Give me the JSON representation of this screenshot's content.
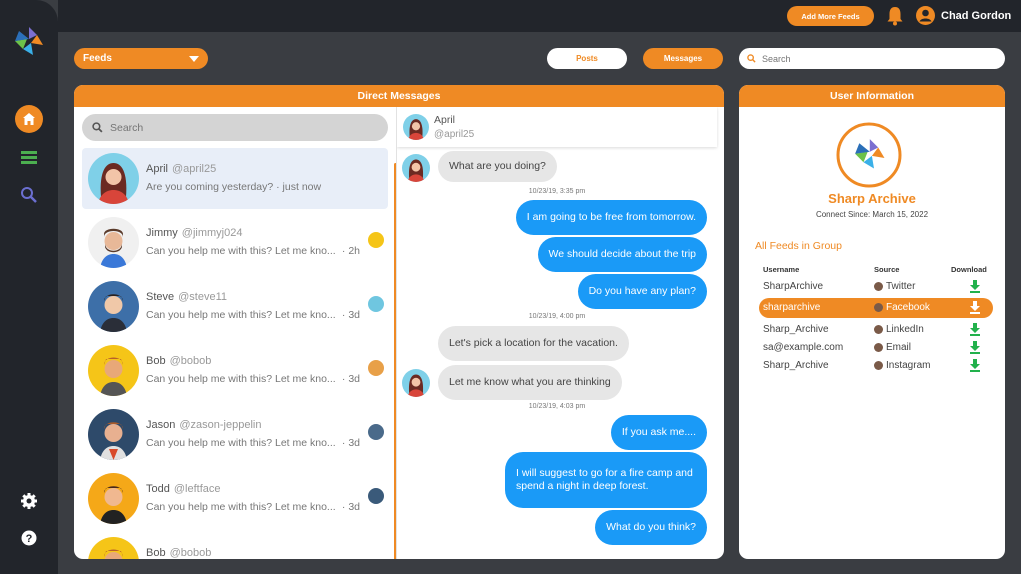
{
  "topbar": {
    "add_feeds_label": "Add More Feeds",
    "user_name": "Chad Gordon"
  },
  "toolbar": {
    "feeds_label": "Feeds",
    "posts_label": "Posts",
    "messages_label": "Messages",
    "search_placeholder": "Search"
  },
  "dm": {
    "title": "Direct Messages",
    "search_placeholder": "Search",
    "conversations": [
      {
        "name": "April",
        "handle": "@april25",
        "message": "Are you coming yesterday? · just now",
        "time": ""
      },
      {
        "name": "Jimmy",
        "handle": "@jimmyj024",
        "message": "Can you help me with this?  Let me kno...",
        "time": "· 2h"
      },
      {
        "name": "Steve",
        "handle": "@steve11",
        "message": "Can you help me with this?  Let me kno...",
        "time": "· 3d"
      },
      {
        "name": "Bob",
        "handle": "@bobob",
        "message": "Can you help me with this?  Let me kno...",
        "time": "· 3d"
      },
      {
        "name": "Jason",
        "handle": "@zason-jeppelin",
        "message": "Can you help me with this?  Let me kno...",
        "time": "· 3d"
      },
      {
        "name": "Todd",
        "handle": "@leftface",
        "message": "Can you help me with this?  Let me kno...",
        "time": "· 3d"
      },
      {
        "name": "Bob",
        "handle": "@bobob",
        "message": "",
        "time": ""
      }
    ]
  },
  "chat": {
    "contact_name": "April",
    "contact_handle": "@april25",
    "messages": [
      {
        "dir": "in",
        "text": "What are you doing?"
      },
      {
        "stamp": "10/23/19, 3:35 pm"
      },
      {
        "dir": "out",
        "text": "I am going to be free from tomorrow."
      },
      {
        "dir": "out",
        "text": "We should decide about the trip"
      },
      {
        "dir": "out",
        "text": "Do you have any plan?"
      },
      {
        "stamp": "10/23/19, 4:00 pm"
      },
      {
        "dir": "in",
        "text": "Let's pick a location for the vacation."
      },
      {
        "dir": "in",
        "text": "Let me know what you are thinking"
      },
      {
        "stamp": "10/23/19, 4:03 pm"
      },
      {
        "dir": "out",
        "text": "If you ask me...."
      },
      {
        "dir": "out",
        "text": "I will suggest to go for a fire camp and spend a night in deep forest."
      },
      {
        "dir": "out",
        "text": "What do you think?"
      }
    ]
  },
  "user_info": {
    "title": "User Information",
    "name": "Sharp Archive",
    "since": "Connect Since: March 15, 2022",
    "group_label": "All Feeds in Group",
    "columns": {
      "username": "Username",
      "source": "Source",
      "download": "Download"
    },
    "feeds": [
      {
        "username": "SharpArchive",
        "source": "Twitter"
      },
      {
        "username": "sharparchive",
        "source": "Facebook"
      },
      {
        "username": "Sharp_Archive",
        "source": "LinkedIn"
      },
      {
        "username": "sa@example.com",
        "source": "Email"
      },
      {
        "username": "Sharp_Archive",
        "source": "Instagram"
      }
    ]
  },
  "colors": {
    "accent": "#ef8a24",
    "bubble_out": "#1a9af7",
    "download": "#22b14c"
  },
  "icons": [
    "home-icon",
    "feed-list-icon",
    "search-icon",
    "settings-icon",
    "help-icon",
    "bell-icon",
    "user-icon",
    "download-icon"
  ]
}
